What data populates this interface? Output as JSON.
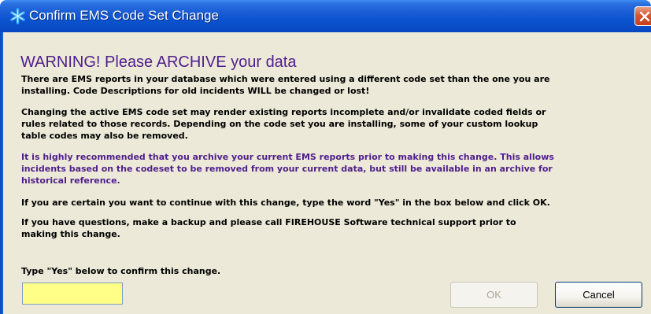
{
  "window": {
    "title": "Confirm EMS Code Set Change",
    "title_icon": "asterisk-star-icon",
    "close_icon": "close-icon"
  },
  "heading": "WARNING!  Please ARCHIVE your data",
  "paragraphs": [
    {
      "lines": [
        "There are EMS reports in your database which were entered using a different code set than the one you are",
        "installing.  Code Descriptions for old incidents WILL be changed or lost!"
      ]
    },
    {
      "lines": [
        "Changing the active EMS code set may render existing reports incomplete and/or invalidate coded fields or",
        "rules related to those records. Depending on the code set you are installing, some of your custom lookup",
        "table codes may also be removed."
      ]
    },
    {
      "lines": [
        "It is highly recommended that you archive your current EMS reports prior to making this change.  This allows",
        "incidents based on the codeset to be removed from your current data, but still be available in an archive for",
        "historical reference."
      ]
    },
    {
      "lines": [
        "If you are certain you want to continue with this change, type the word \"Yes\" in the box below and click OK."
      ]
    },
    {
      "lines": [
        "If you have questions, make a backup and please call FIREHOUSE Software technical support prior to",
        "making this change."
      ]
    }
  ],
  "confirm_label": "Type \"Yes\" below to confirm this change.",
  "confirm_input": {
    "value": "",
    "placeholder": ""
  },
  "buttons": {
    "ok_label": "OK",
    "cancel_label": "Cancel"
  },
  "colors": {
    "titlebar_blue": "#0a4ec8",
    "warning_purple": "#4f1e8c",
    "dialog_background": "#ece9d8",
    "input_background": "#ffff88",
    "close_button_red": "#d9572f"
  }
}
